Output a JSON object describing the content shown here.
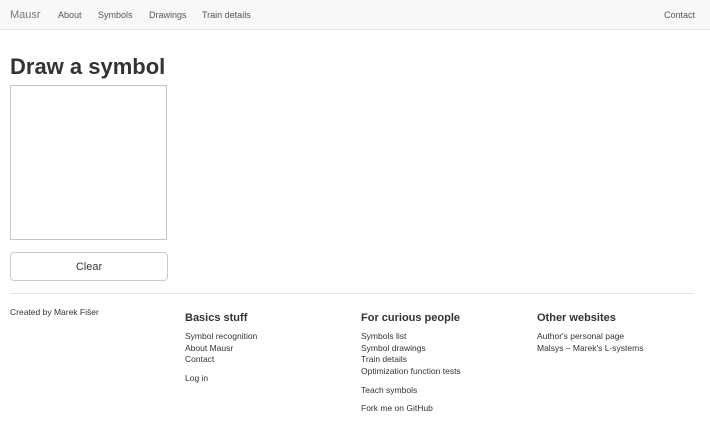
{
  "navbar": {
    "brand": "Mausr",
    "items": [
      {
        "label": "About"
      },
      {
        "label": "Symbols"
      },
      {
        "label": "Drawings"
      },
      {
        "label": "Train details"
      }
    ],
    "contact": "Contact"
  },
  "main": {
    "title": "Draw a symbol",
    "clear_label": "Clear"
  },
  "footer": {
    "credit": "Created by Marek Fišer",
    "columns": [
      {
        "heading": "Basics stuff",
        "links": [
          "Symbol recognition",
          "About Mausr",
          "Contact",
          "Log in"
        ]
      },
      {
        "heading": "For curious people",
        "links": [
          "Symbols list",
          "Symbol drawings",
          "Train details",
          "Optimization function tests",
          "Teach symbols",
          "Fork me on GitHub"
        ]
      },
      {
        "heading": "Other websites",
        "links": [
          "Author's personal page",
          "Malsys – Marek's L-systems"
        ]
      }
    ]
  }
}
